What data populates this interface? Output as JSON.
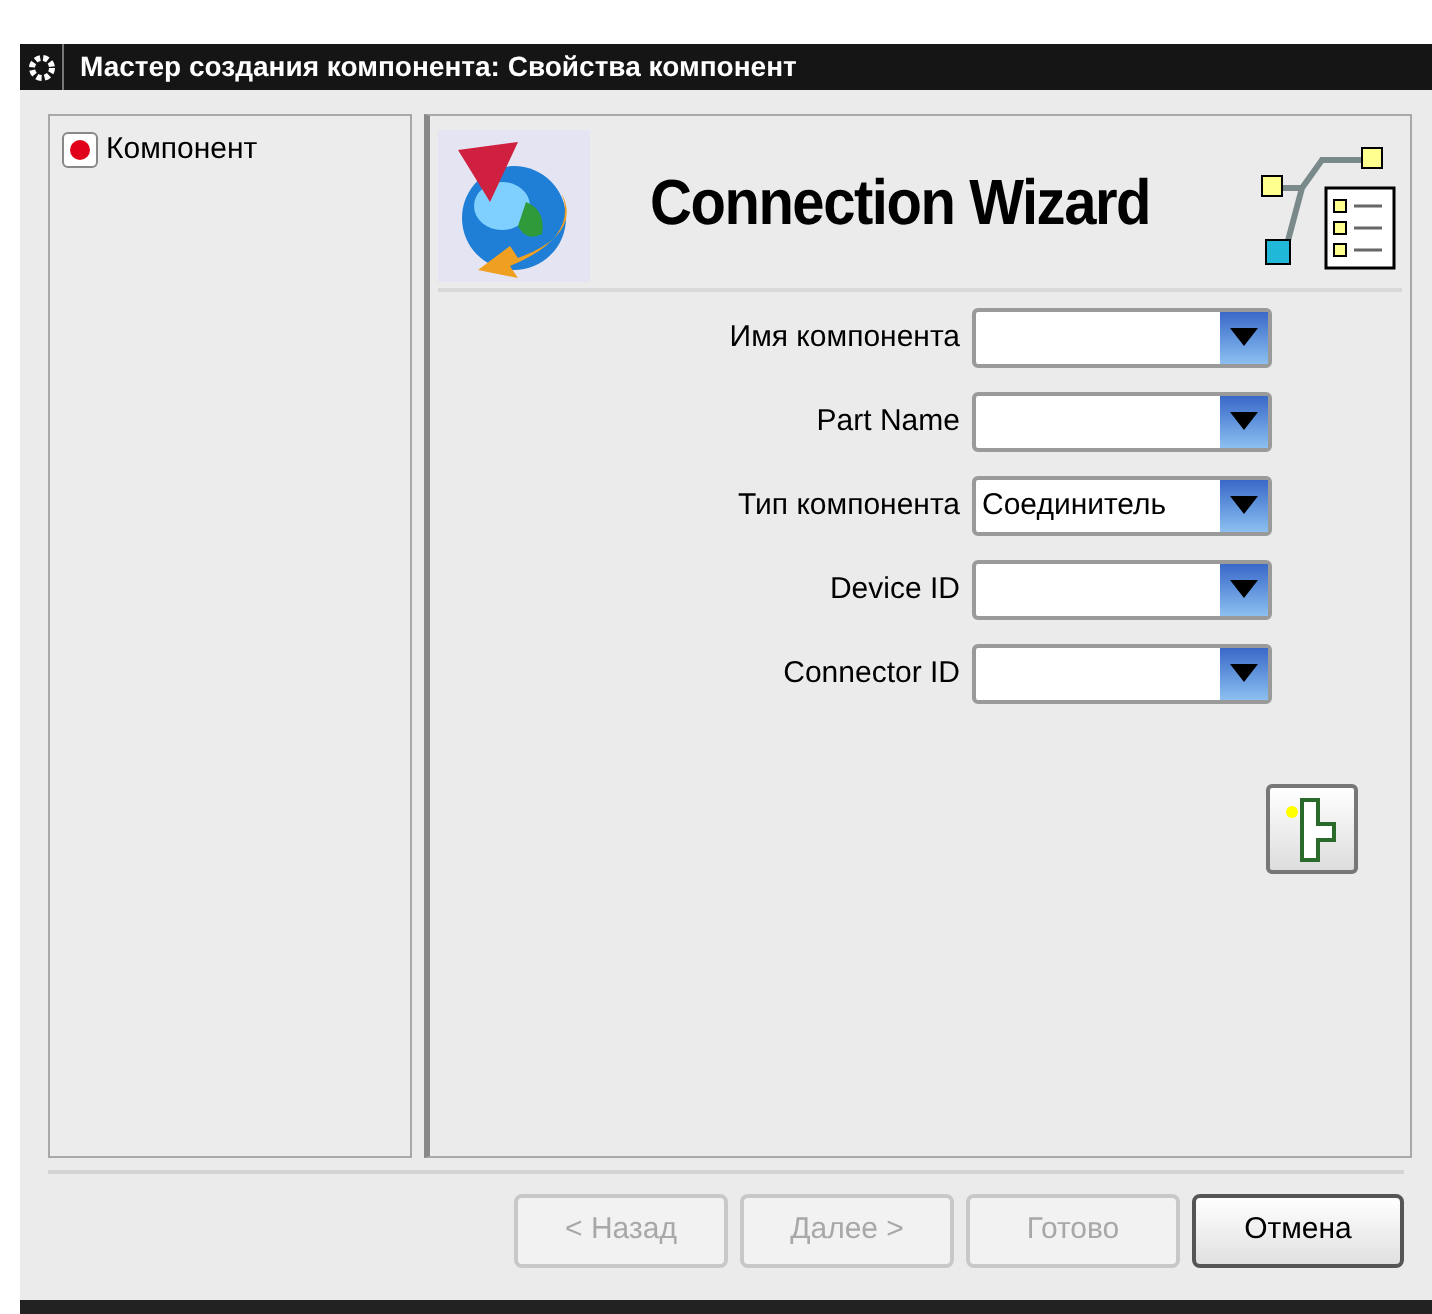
{
  "window": {
    "title": "Мастер создания компонента: Свойства компонент"
  },
  "steps": [
    {
      "label": "Компонент",
      "selected": true
    }
  ],
  "header": {
    "title": "Connection Wizard"
  },
  "fields": [
    {
      "label": "Имя компонента"
    },
    {
      "label": "Part Name"
    },
    {
      "label": "Тип компонента",
      "value": "Соединитель"
    },
    {
      "label": "Device ID"
    },
    {
      "label": "Connector ID"
    }
  ],
  "buttons": [
    {
      "label": "< Назад",
      "disabled": true
    },
    {
      "label": "Далее >",
      "disabled": true
    },
    {
      "label": "Готово",
      "disabled": true
    },
    {
      "label": "Отмена",
      "disabled": false
    }
  ]
}
